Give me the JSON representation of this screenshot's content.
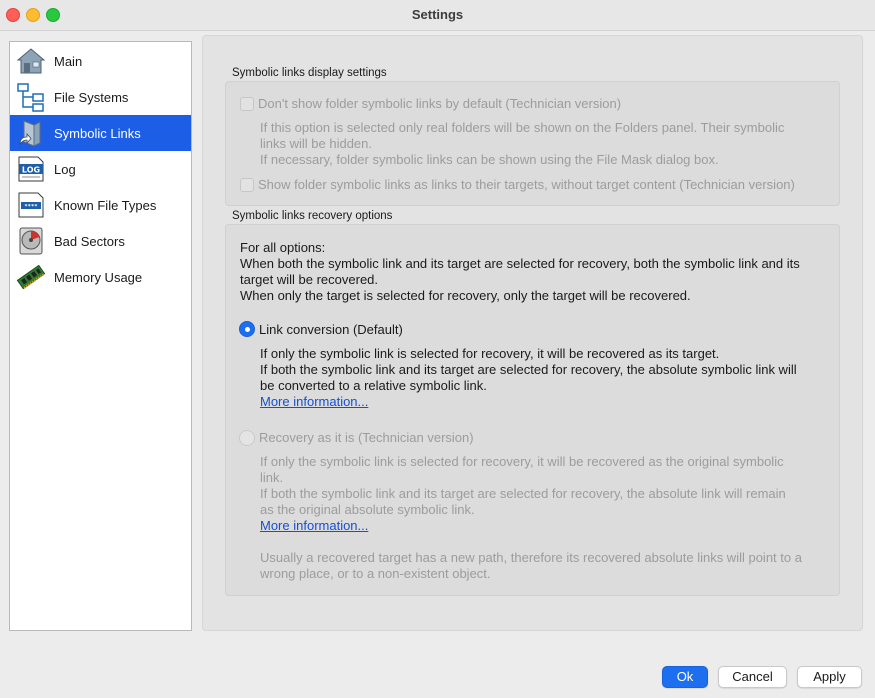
{
  "window": {
    "title": "Settings"
  },
  "sidebar": {
    "items": [
      {
        "label": "Main",
        "icon": "house-icon"
      },
      {
        "label": "File Systems",
        "icon": "tree-icon"
      },
      {
        "label": "Symbolic Links",
        "icon": "symlink-icon",
        "selected": true
      },
      {
        "label": "Log",
        "icon": "log-icon"
      },
      {
        "label": "Known File Types",
        "icon": "filetypes-icon"
      },
      {
        "label": "Bad Sectors",
        "icon": "disk-icon"
      },
      {
        "label": "Memory Usage",
        "icon": "memory-icon"
      }
    ]
  },
  "display_settings": {
    "group_title": "Symbolic links display settings",
    "option1_label": "Don't show folder symbolic links by default (Technician version)",
    "option1_desc1": "If this option is selected only real folders will be shown on the Folders panel. Their symbolic",
    "option1_desc2": "links will be hidden.",
    "option1_desc3": "If necessary, folder symbolic links can be shown using the File Mask dialog box.",
    "option2_label": "Show folder symbolic links as links to their targets, without target content (Technician version)"
  },
  "recovery_options": {
    "group_title": "Symbolic links recovery options",
    "intro1": "For all options:",
    "intro2": "When both the symbolic link and its target are selected for recovery, both the symbolic link and its",
    "intro3": "target will be recovered.",
    "intro4": "When only the target is selected for recovery, only the target will be recovered.",
    "radio1_label": "Link conversion (Default)",
    "radio1_desc1": "If only the symbolic link is selected for recovery, it will be recovered as its target.",
    "radio1_desc2": "If both the symbolic link and its target are selected for recovery, the absolute symbolic link will",
    "radio1_desc3": "be converted to a relative symbolic link.",
    "radio1_more": "More information...",
    "radio2_label": "Recovery as it is (Technician version)",
    "radio2_desc1": "If only the symbolic link is selected for recovery, it will be recovered as the original symbolic",
    "radio2_desc2": "link.",
    "radio2_desc3": "If both the symbolic link and its target are selected for recovery, the absolute link will remain",
    "radio2_desc4": "as the original absolute symbolic link.",
    "radio2_more": "More information...",
    "note1": "Usually a recovered target has a new path, therefore its recovered absolute links will point to a",
    "note2": "wrong place, or to a non-existent object."
  },
  "buttons": {
    "ok": "Ok",
    "cancel": "Cancel",
    "apply": "Apply"
  },
  "colors": {
    "accent": "#1d5ee6",
    "link": "#1450d0",
    "disabled_text": "#9c9c9c"
  }
}
